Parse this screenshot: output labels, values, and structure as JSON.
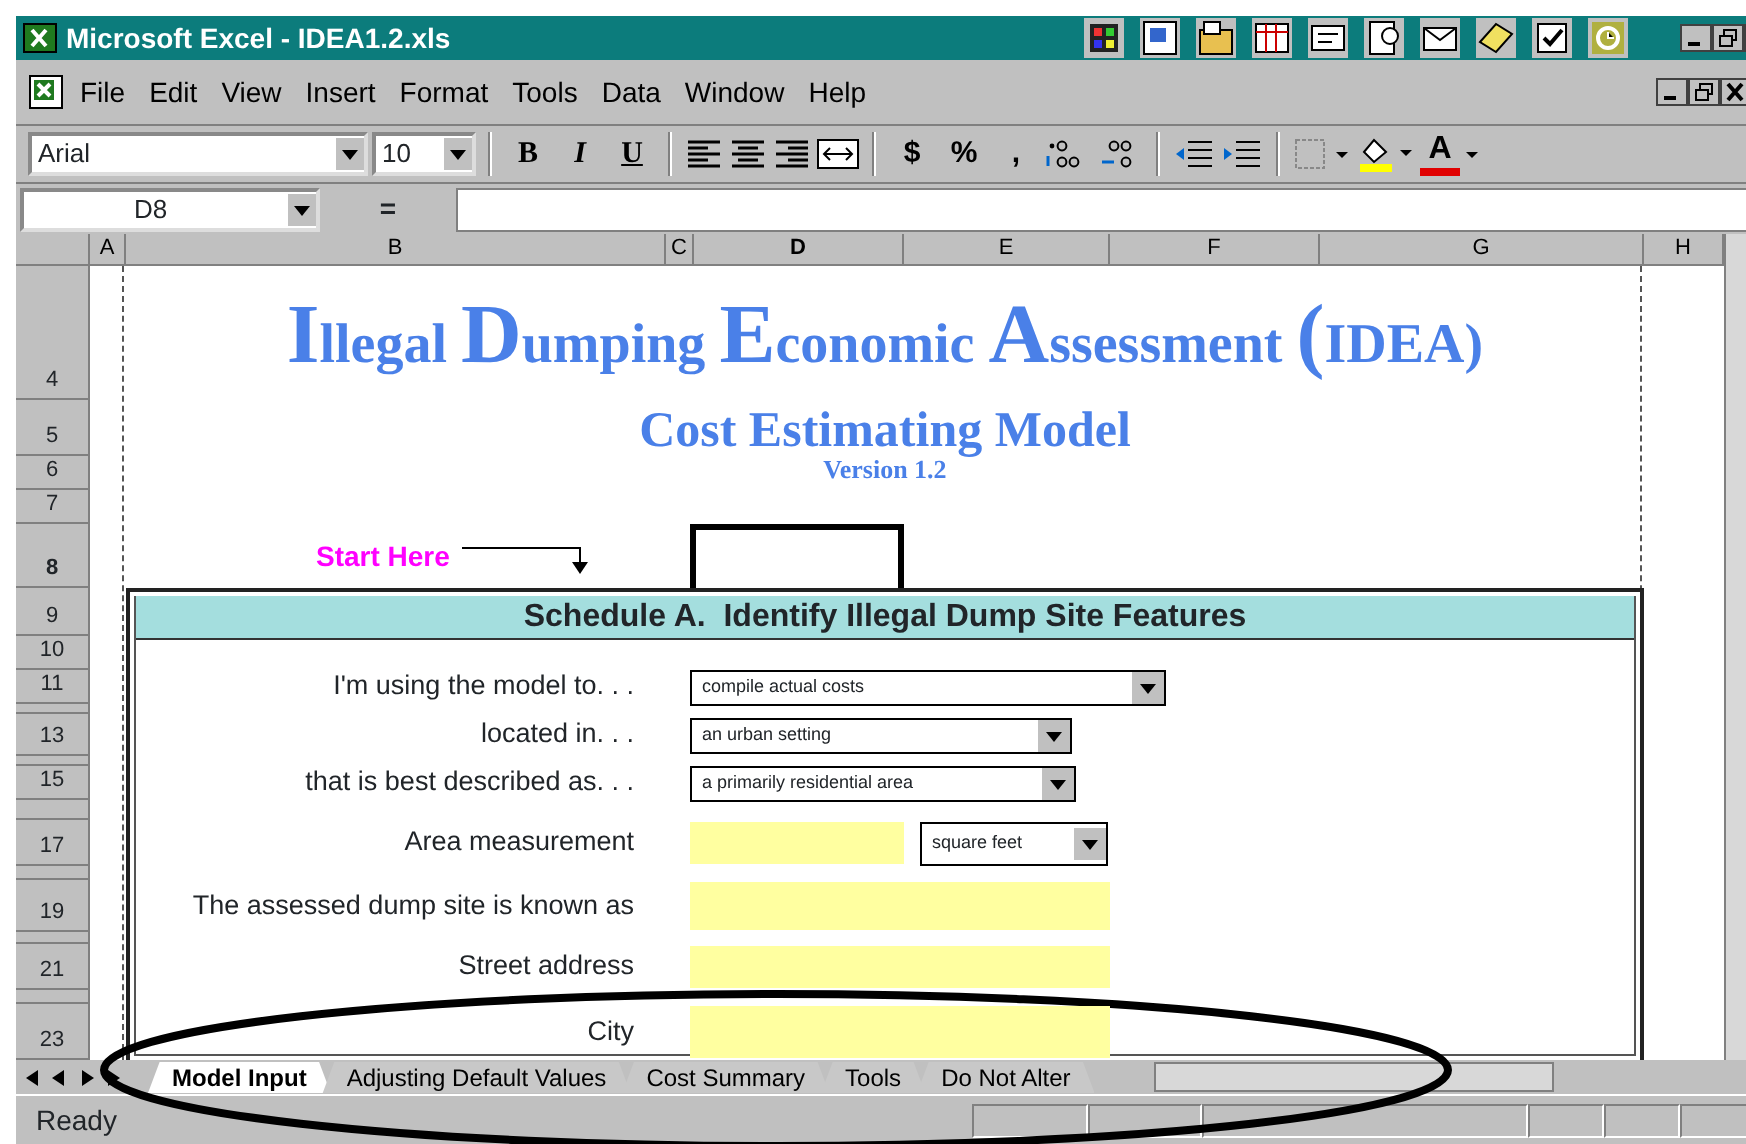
{
  "window": {
    "title": "Microsoft Excel - IDEA1.2.xls"
  },
  "menu": [
    "File",
    "Edit",
    "View",
    "Insert",
    "Format",
    "Tools",
    "Data",
    "Window",
    "Help"
  ],
  "toolbar": {
    "font": "Arial",
    "size": "10",
    "style_buttons": [
      "B",
      "I",
      "U"
    ],
    "number_buttons": [
      "$",
      "%",
      ","
    ],
    "font_color_button": "A"
  },
  "formula_bar": {
    "name_box": "D8",
    "equals": "="
  },
  "columns": [
    "A",
    "B",
    "C",
    "D",
    "E",
    "F",
    "G",
    "H"
  ],
  "row_numbers": [
    "4",
    "5",
    "6",
    "7",
    "8",
    "9",
    "10",
    "11",
    "13",
    "15",
    "17",
    "19",
    "21",
    "23"
  ],
  "sheet": {
    "title": "Illegal Dumping Economic Assessment (IDEA)",
    "subtitle": "Cost Estimating Model",
    "version": "Version 1.2",
    "start_label": "Start Here"
  },
  "schedule": {
    "heading": "Schedule A.  Identify Illegal Dump Site Features",
    "fields": [
      {
        "kind": "dropdown",
        "label": "I'm using the model to. . .",
        "value": "compile actual costs"
      },
      {
        "kind": "dropdown",
        "label": "located in. . .",
        "value": "an urban setting"
      },
      {
        "kind": "dropdown",
        "label": "that is best described as. . .",
        "value": "a primarily residential area"
      },
      {
        "kind": "input_unit",
        "label": "Area measurement",
        "unit": "square feet"
      },
      {
        "kind": "input",
        "label": "The assessed dump site is known as"
      },
      {
        "kind": "input",
        "label": "Street address"
      },
      {
        "kind": "input",
        "label": "City"
      }
    ]
  },
  "sheet_tabs": [
    {
      "label": "Model Input",
      "selected": true
    },
    {
      "label": "Adjusting Default Values",
      "selected": false
    },
    {
      "label": "Cost Summary",
      "selected": false
    },
    {
      "label": "Tools",
      "selected": false
    },
    {
      "label": "Do Not Alter",
      "selected": false
    }
  ],
  "status_bar": {
    "text": "Ready"
  }
}
